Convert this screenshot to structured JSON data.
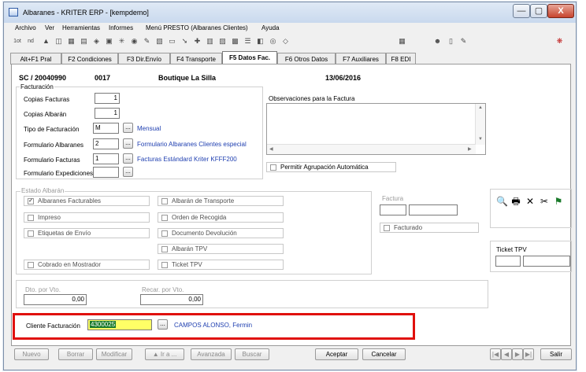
{
  "window": {
    "title": "Albaranes - KRITER ERP -  [kempdemo]",
    "minimize_label": "—",
    "restore_label": "▢",
    "close_label": "X"
  },
  "menu": [
    "Archivo",
    "Ver",
    "Herramientas",
    "Informes",
    "Menú PRESTO (Albaranes Clientes)",
    "Ayuda"
  ],
  "toolbar": {
    "left_labels": [
      "1ot",
      "nd"
    ]
  },
  "tabs": [
    "Alt+F1 Pral",
    "F2 Condiciones",
    "F3 Dir.Envío",
    "F4 Transporte",
    "F5 Datos Fac.",
    "F6 Otros Datos",
    "F7 Auxiliares",
    "F8 EDI"
  ],
  "header": {
    "doc": "SC / 20040990",
    "code": "0017",
    "client": "Boutique La Silla",
    "date": "13/06/2016"
  },
  "facturacion": {
    "section_label": "Facturación",
    "copias_facturas_label": "Copias Facturas",
    "copias_facturas": "1",
    "copias_albaran_label": "Copias Albarán",
    "copias_albaran": "1",
    "tipo_label": "Tipo de Facturación",
    "tipo": "M",
    "tipo_desc": "Mensual",
    "form_albaranes_label": "Formulario Albaranes",
    "form_albaranes": "2",
    "form_albaranes_desc": "Formulario Albaranes Clientes especial",
    "form_facturas_label": "Formulario Facturas",
    "form_facturas": "1",
    "form_facturas_desc": "Facturas Estándard Kriter KFFF200",
    "form_expediciones_label": "Formulario Expediciones",
    "form_expediciones": "",
    "dots": "..."
  },
  "observaciones": {
    "label": "Observaciones para la Factura",
    "agrupacion_label": "Permitir Agrupación Automática"
  },
  "estado": {
    "label": "Estado Albarán",
    "items_left": [
      "Albaranes Facturables",
      "Impreso",
      "Etiquetas de Envío",
      "Cobrado en Mostrador"
    ],
    "items_right": [
      "Albarán de Transporte",
      "Orden de Recogida",
      "Documento Devolución",
      "Albarán TPV",
      "Ticket TPV"
    ],
    "checked": "✓"
  },
  "factura": {
    "label": "Factura",
    "facturado_label": "Facturado"
  },
  "ticket": {
    "label": "Ticket TPV"
  },
  "action_icons": [
    "preview-icon",
    "print-icon",
    "delete-icon",
    "scissors-icon",
    "bookmark-icon"
  ],
  "action_glyphs": [
    "🔍",
    "🖶",
    "✕",
    "✂",
    "⚑"
  ],
  "vto": {
    "dto_label": "Dto. por Vto.",
    "dto_value": "0,00",
    "recar_label": "Recar. por Vto.",
    "recar_value": "0,00"
  },
  "cliente": {
    "label": "Cliente Facturación",
    "code": "4300025",
    "name": "CAMPOS ALONSO, Fermin"
  },
  "buttons": {
    "nuevo": "Nuevo",
    "borrar": "Borrar",
    "modificar": "Modificar",
    "ir_a": "▲ Ir a ...",
    "avanzada": "Avanzada",
    "buscar": "Buscar",
    "aceptar": "Aceptar",
    "cancelar": "Cancelar",
    "salir": "Salir",
    "nav": [
      "|◀",
      "◀",
      "▶",
      "▶|"
    ]
  },
  "colors": {
    "highlight_border": "#e0100c",
    "link": "#1f3fb0",
    "selected_input": "#ffff66"
  }
}
